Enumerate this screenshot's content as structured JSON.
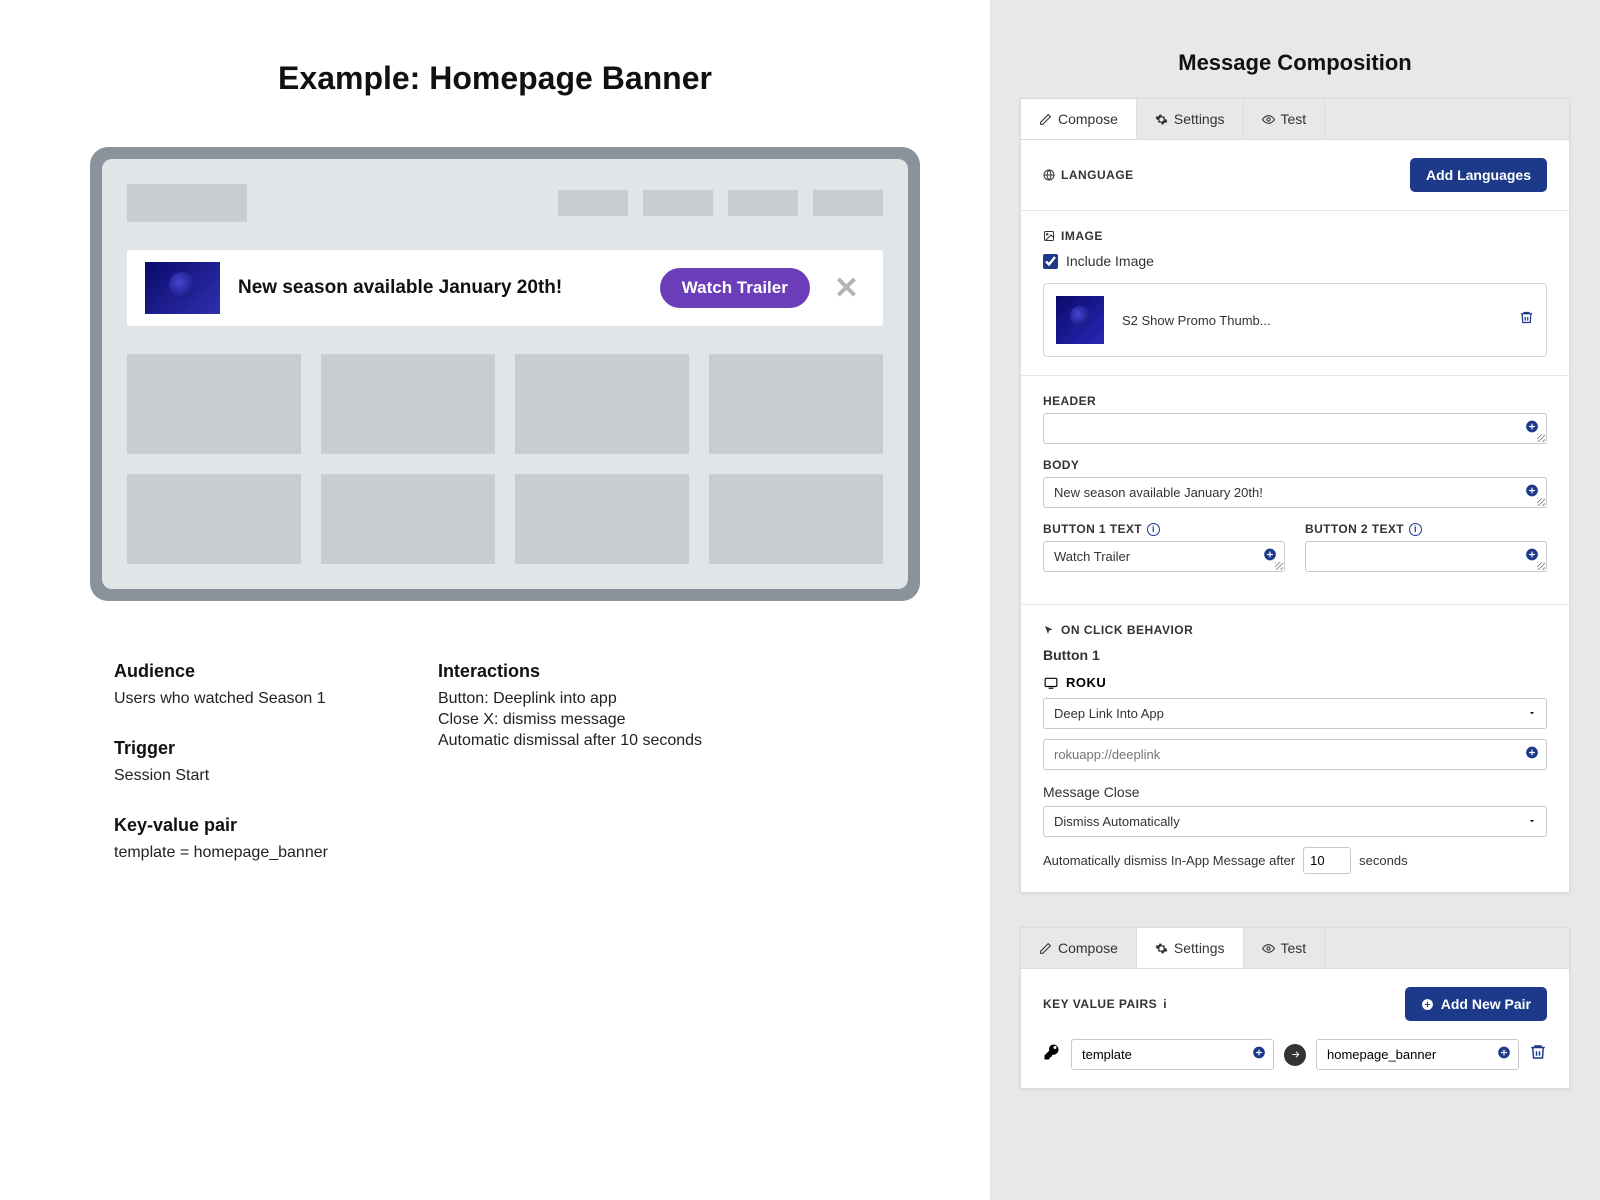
{
  "left": {
    "title": "Example: Homepage Banner",
    "banner_text": "New season available January 20th!",
    "banner_button": "Watch Trailer",
    "audience_h": "Audience",
    "audience_p": "Users who watched Season 1",
    "trigger_h": "Trigger",
    "trigger_p": "Session Start",
    "kvp_h": "Key-value pair",
    "kvp_p": "template = homepage_banner",
    "interactions_h": "Interactions",
    "interactions_p1": "Button: Deeplink into app",
    "interactions_p2": "Close X: dismiss message",
    "interactions_p3": "Automatic dismissal after 10 seconds"
  },
  "right": {
    "title": "Message Composition",
    "tabs": {
      "compose": "Compose",
      "settings": "Settings",
      "test": "Test"
    },
    "language": {
      "label": "LANGUAGE",
      "button": "Add Languages"
    },
    "image": {
      "label": "IMAGE",
      "checkbox": "Include Image",
      "file": "S2 Show Promo Thumb..."
    },
    "header_label": "HEADER",
    "body_label": "BODY",
    "body_value": "New season available January 20th!",
    "btn1_label": "BUTTON 1 TEXT",
    "btn1_value": "Watch Trailer",
    "btn2_label": "BUTTON 2 TEXT",
    "click_label": "ON CLICK BEHAVIOR",
    "click_sublabel": "Button 1",
    "platform": "ROKU",
    "deeplink_select": "Deep Link Into App",
    "deeplink_placeholder": "rokuapp://deeplink",
    "msg_close_label": "Message Close",
    "msg_close_select": "Dismiss Automatically",
    "dismiss_before": "Automatically dismiss In-App Message after",
    "dismiss_value": "10",
    "dismiss_after": "seconds",
    "kvp_label": "KEY VALUE PAIRS",
    "kvp_button": "Add New Pair",
    "kvp_key": "template",
    "kvp_value": "homepage_banner"
  }
}
